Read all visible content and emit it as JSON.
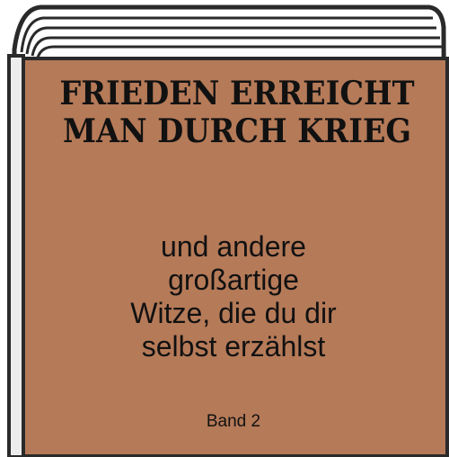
{
  "book": {
    "title_lines": [
      "FRIEDEN ERREICHT",
      "MAN DURCH KRIEG"
    ],
    "subtitle_lines": [
      "und andere",
      "großartige",
      "Witze, die du dir",
      "selbst erzählst"
    ],
    "volume": "Band 2"
  },
  "colors": {
    "cover": "#b57a58",
    "pages": "#e7e7e7",
    "outline": "#2a2a2a",
    "text": "#111111"
  }
}
